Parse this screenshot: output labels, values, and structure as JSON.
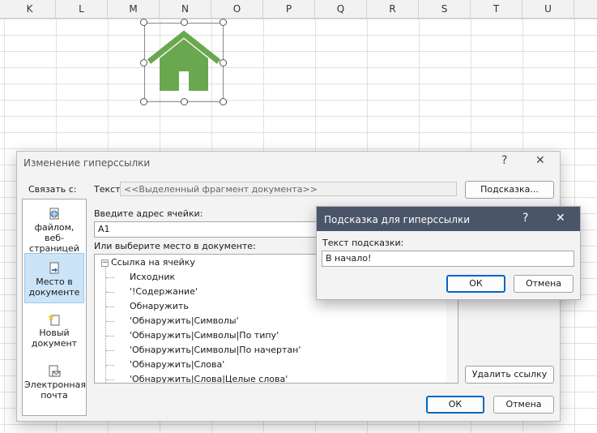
{
  "columns": [
    "K",
    "L",
    "M",
    "N",
    "O",
    "P",
    "Q",
    "R",
    "S",
    "T",
    "U"
  ],
  "dialog": {
    "title": "Изменение гиперссылки",
    "help": "?",
    "close": "✕",
    "link_with": "Связать с:",
    "text_label": "Текст:",
    "text_value": "<<Выделенный фрагмент документа>>",
    "tooltip_button": "Подсказка...",
    "cell_label": "Введите адрес ячейки:",
    "cell_value": "A1",
    "place_label": "Или выберите место в документе:",
    "tree": [
      "Ссылка на ячейку",
      "Исходник",
      "'!Содержание'",
      "Обнаружить",
      "'Обнаружить|Символы'",
      "'Обнаружить|Символы|По типу'",
      "'Обнаружить|Символы|По начертан'",
      "'Обнаружить|Слова'",
      "'Обнаружить|Слова|Целые слова'"
    ],
    "tree_toggle": "−",
    "remove_link": "Удалить ссылку",
    "ok": "ОК",
    "cancel": "Отмена",
    "sidebar": [
      {
        "line1": "файлом, веб-",
        "line2": "страницей",
        "icon": "file-globe-icon"
      },
      {
        "line1": "Место в",
        "line2": "документе",
        "icon": "document-place-icon"
      },
      {
        "line1": "Новый",
        "line2": "документ",
        "icon": "new-document-icon"
      },
      {
        "line1": "Электронная",
        "line2": "почта",
        "icon": "email-icon"
      }
    ]
  },
  "tooltip_dialog": {
    "title": "Подсказка для гиперссылки",
    "help": "?",
    "close": "✕",
    "label": "Текст подсказки:",
    "value": "В начало!",
    "ok": "ОК",
    "cancel": "Отмена"
  },
  "colors": {
    "house": "#6aa84f",
    "title_bar": "#4a5568",
    "selected": "#cce4f7"
  }
}
